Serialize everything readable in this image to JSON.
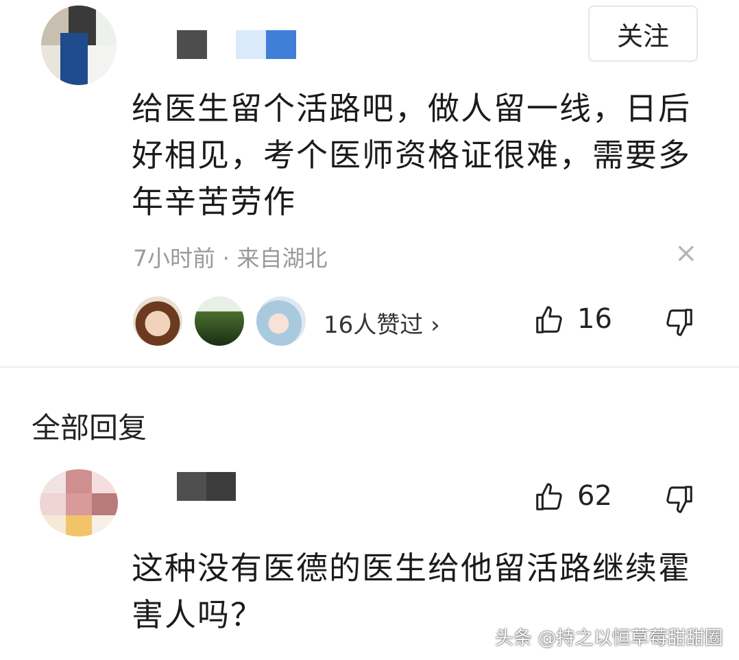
{
  "comment": {
    "follow_label": "关注",
    "text": "给医生留个活路吧，做人留一线，日后好相见，考个医师资格证很难，需要多年辛苦劳作",
    "line1": "给医生留个活路吧，做人留一线，日后",
    "line2": "好相见，考个医师资格证很难，需要多",
    "line3": "年辛苦劳作",
    "meta": "7小时前 · 来自湖北",
    "close_icon": "×",
    "likers_text": "16人赞过 ›",
    "like_count": "16"
  },
  "replies": {
    "section_title": "全部回复",
    "items": [
      {
        "like_count": "62",
        "line1": "这种没有医德的医生给他留活路继续霍",
        "line2": "害人吗？"
      }
    ]
  },
  "watermark": "头条 @持之以恒草莓甜甜圈",
  "colors": {
    "text_primary": "#1b1b1b",
    "text_meta": "#9a9a9a",
    "divider": "#ececec",
    "background": "#ffffff"
  }
}
